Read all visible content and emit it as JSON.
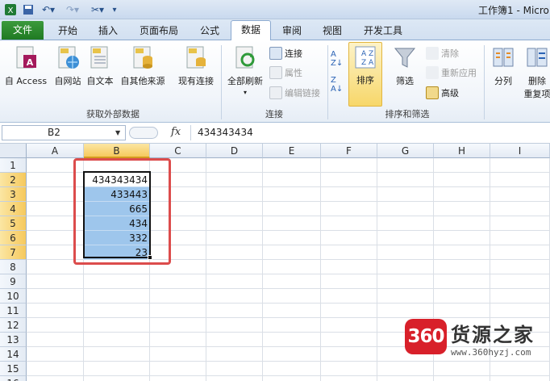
{
  "title_bar": {
    "title": "工作簿1 - Micro"
  },
  "tabs": [
    "文件",
    "开始",
    "插入",
    "页面布局",
    "公式",
    "数据",
    "审阅",
    "视图",
    "开发工具"
  ],
  "ribbon": {
    "external_data": {
      "label": "获取外部数据",
      "access": "自 Access",
      "web": "自网站",
      "text": "自文本",
      "other": "自其他来源",
      "existing": "现有连接"
    },
    "connections": {
      "label": "连接",
      "refresh_all": "全部刷新",
      "connections": "连接",
      "properties": "属性",
      "edit_links": "编辑链接"
    },
    "sort_filter": {
      "label": "排序和筛选",
      "sort": "排序",
      "filter": "筛选",
      "clear": "清除",
      "reapply": "重新应用",
      "advanced": "高级"
    },
    "data_tools": {
      "split": "分列",
      "remove_dup_1": "删除",
      "remove_dup_2": "重复项"
    }
  },
  "formula_bar": {
    "name_box": "B2",
    "fx": "fx",
    "value": "434343434"
  },
  "grid": {
    "columns": [
      "A",
      "B",
      "C",
      "D",
      "E",
      "F",
      "G",
      "H",
      "I"
    ],
    "rows": [
      "1",
      "2",
      "3",
      "4",
      "5",
      "6",
      "7",
      "8",
      "9",
      "10",
      "11",
      "12",
      "13",
      "14",
      "15",
      "16"
    ],
    "selected_column": "B",
    "cells": {
      "B2": "434343434",
      "B3": "433443",
      "B4": "665",
      "B5": "434",
      "B6": "332",
      "B7": "23"
    }
  },
  "watermark": {
    "logo": "360",
    "name": "货源之家",
    "url": "www.360hyzj.com"
  },
  "colors": {
    "file_tab": "#2a8a2d",
    "selection_fill": "#9ec6ec",
    "annotation_border": "#dc4c4c",
    "header_selected": "#f6c95d",
    "watermark_logo": "#d8202a"
  }
}
